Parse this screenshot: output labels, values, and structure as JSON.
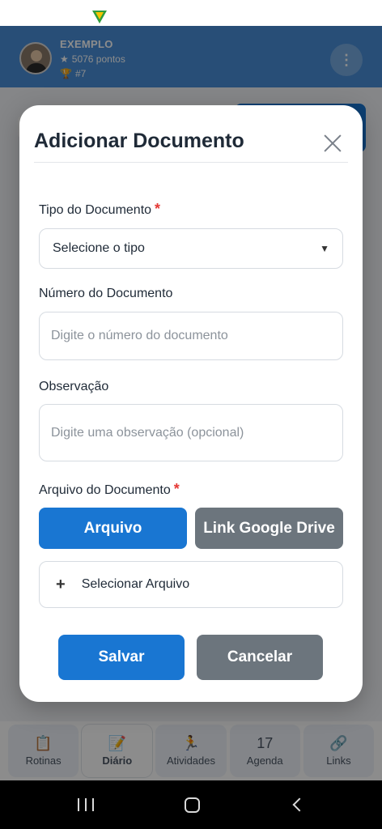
{
  "header": {
    "user_name": "EXEMPLO",
    "points": "5076 pontos",
    "rank": "#7"
  },
  "bottom_nav": {
    "items": [
      {
        "label": "Rotinas",
        "icon": "clipboard-icon"
      },
      {
        "label": "Diário",
        "icon": "notebook-icon"
      },
      {
        "label": "Atividades",
        "icon": "runner-icon"
      },
      {
        "label": "Agenda",
        "icon": "calendar-icon"
      },
      {
        "label": "Links",
        "icon": "link-icon"
      }
    ],
    "calendar_day": "17"
  },
  "modal": {
    "title": "Adicionar Documento",
    "tipo_label": "Tipo do Documento",
    "tipo_value": "Selecione o tipo",
    "numero_label": "Número do Documento",
    "numero_placeholder": "Digite o número do documento",
    "obs_label": "Observação",
    "obs_placeholder": "Digite uma observação (opcional)",
    "arquivo_label": "Arquivo do Documento",
    "required_mark": "*",
    "toggle_arquivo": "Arquivo",
    "toggle_drive": "Link Google Drive",
    "select_file": "Selecionar Arquivo",
    "save": "Salvar",
    "cancel": "Cancelar"
  },
  "colors": {
    "primary": "#1976d2",
    "secondary": "#6c757d",
    "required": "#e53935"
  }
}
